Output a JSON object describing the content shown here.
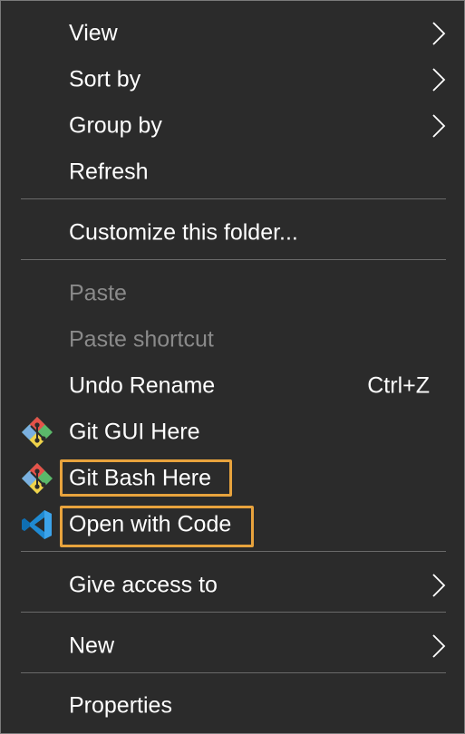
{
  "menu": {
    "view": "View",
    "sort_by": "Sort by",
    "group_by": "Group by",
    "refresh": "Refresh",
    "customize": "Customize this folder...",
    "paste": "Paste",
    "paste_shortcut": "Paste shortcut",
    "undo_rename": "Undo Rename",
    "undo_rename_shortcut": "Ctrl+Z",
    "git_gui": "Git GUI Here",
    "git_bash": "Git Bash Here",
    "open_code": "Open with Code",
    "give_access": "Give access to",
    "new": "New",
    "properties": "Properties"
  },
  "icons": {
    "chevron": "chevron-right-icon",
    "git": "git-icon",
    "vscode": "vscode-icon"
  },
  "colors": {
    "background": "#2b2b2b",
    "text": "#ffffff",
    "disabled_text": "#8a8a8a",
    "highlight": "#e8a33d"
  }
}
